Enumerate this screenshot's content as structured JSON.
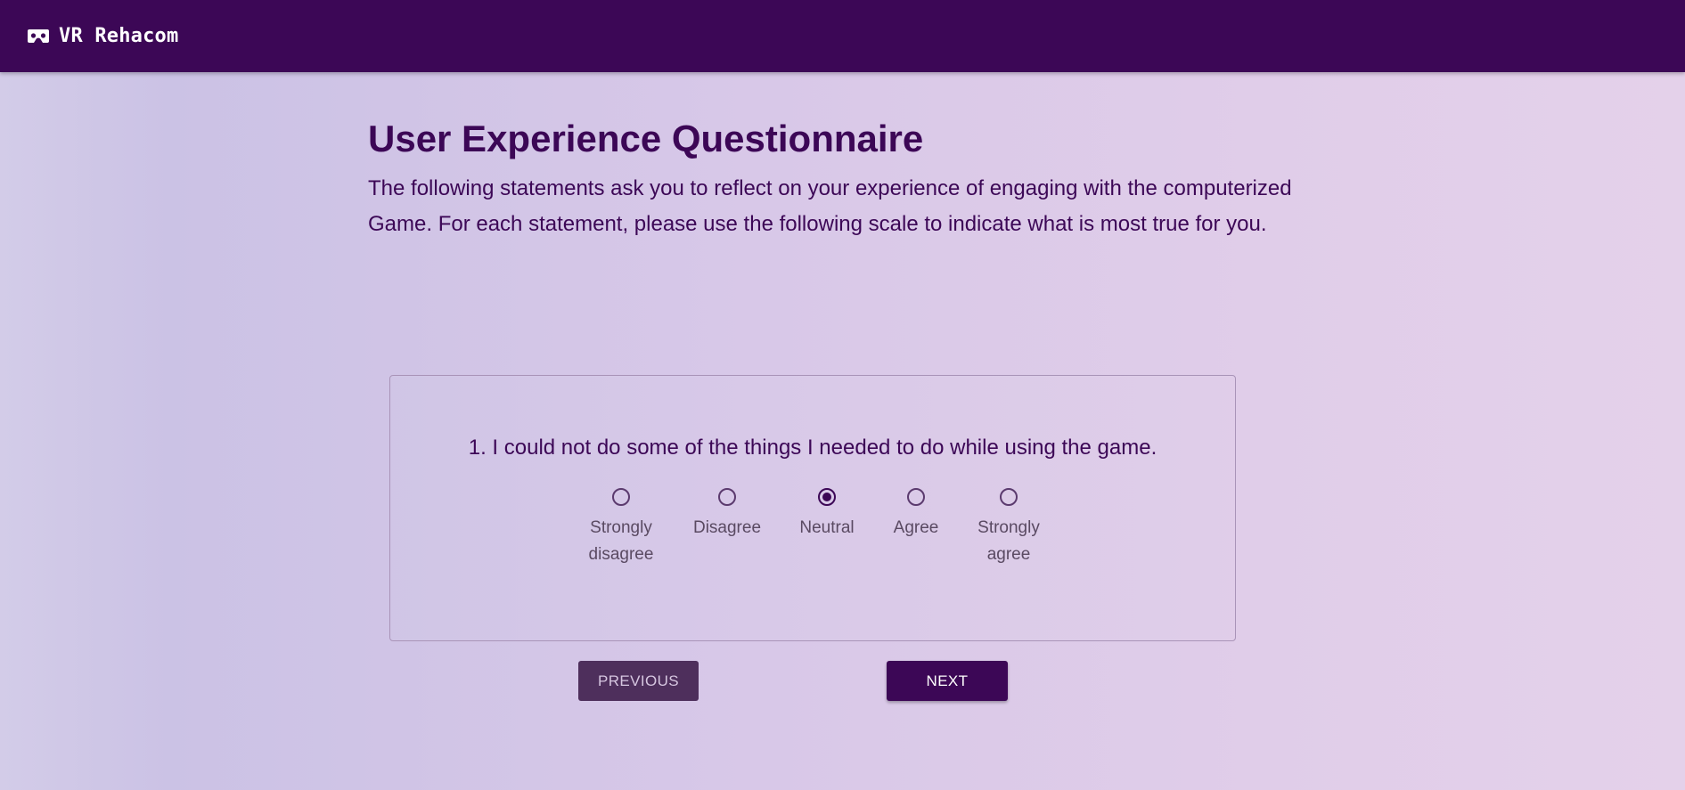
{
  "app": {
    "title": "VR Rehacom",
    "icon": "vr-headset-icon"
  },
  "page": {
    "title": "User Experience Questionnaire",
    "intro": "The following statements ask you to reflect on your experience of engaging with the computerized Game. For each statement, please use the following scale to indicate what is most true for you."
  },
  "question": {
    "text": "1. I could not do some of the things I needed to do while using the game.",
    "selected": "Neutral",
    "options": [
      {
        "label_line1": "Strongly",
        "label_line2": "disagree",
        "selected": false
      },
      {
        "label_line1": "Disagree",
        "label_line2": "",
        "selected": false
      },
      {
        "label_line1": "Neutral",
        "label_line2": "",
        "selected": true
      },
      {
        "label_line1": "Agree",
        "label_line2": "",
        "selected": false
      },
      {
        "label_line1": "Strongly",
        "label_line2": "agree",
        "selected": false
      }
    ]
  },
  "navigation": {
    "previous_label": "PREVIOUS",
    "next_label": "NEXT"
  },
  "colors": {
    "primary": "#3c0756",
    "previous_button": "#4e2f5c",
    "background_start": "#d3cce8",
    "background_end": "#e4d1ea"
  }
}
